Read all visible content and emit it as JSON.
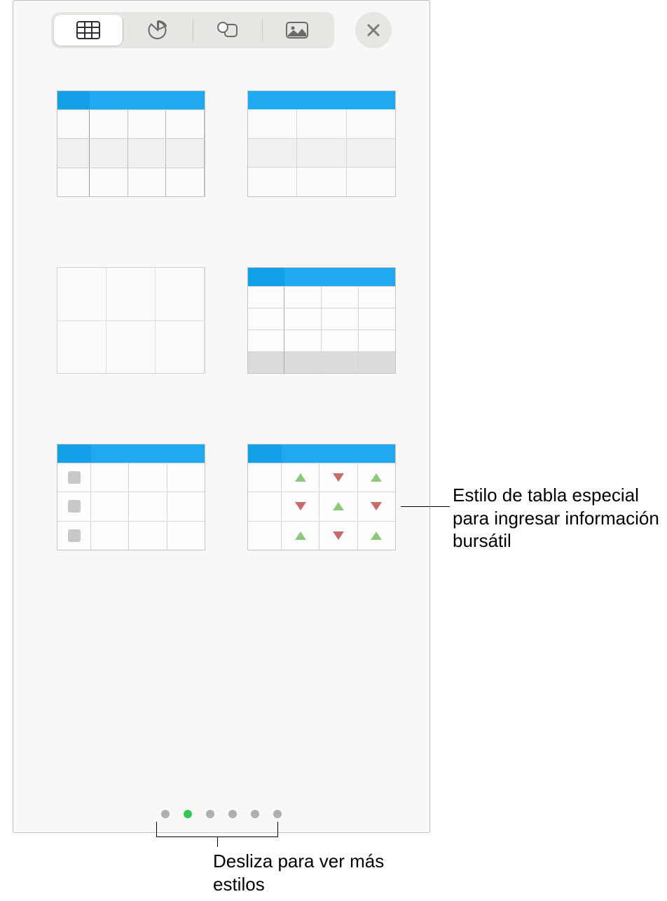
{
  "toolbar": {
    "tabs": [
      {
        "name": "table-tab",
        "active": true
      },
      {
        "name": "chart-tab",
        "active": false
      },
      {
        "name": "shape-tab",
        "active": false
      },
      {
        "name": "media-tab",
        "active": false
      }
    ],
    "close": "close"
  },
  "styles": [
    {
      "name": "table-style-1",
      "kind": "header-alt-rows-narrowcol"
    },
    {
      "name": "table-style-2",
      "kind": "header-alt-rows"
    },
    {
      "name": "table-style-3",
      "kind": "plain-grid"
    },
    {
      "name": "table-style-4",
      "kind": "header-footer"
    },
    {
      "name": "table-style-5",
      "kind": "checklist"
    },
    {
      "name": "table-style-6",
      "kind": "stock-arrows"
    }
  ],
  "pagination": {
    "count": 6,
    "active_index": 1
  },
  "callouts": {
    "stock_style": "Estilo de tabla especial para ingresar información bursátil",
    "swipe_hint": "Desliza para ver más estilos"
  },
  "colors": {
    "header_blue": "#1fa9f0",
    "dot_active": "#34c759",
    "tri_up": "#8ec97a",
    "tri_down": "#c96a6a"
  }
}
